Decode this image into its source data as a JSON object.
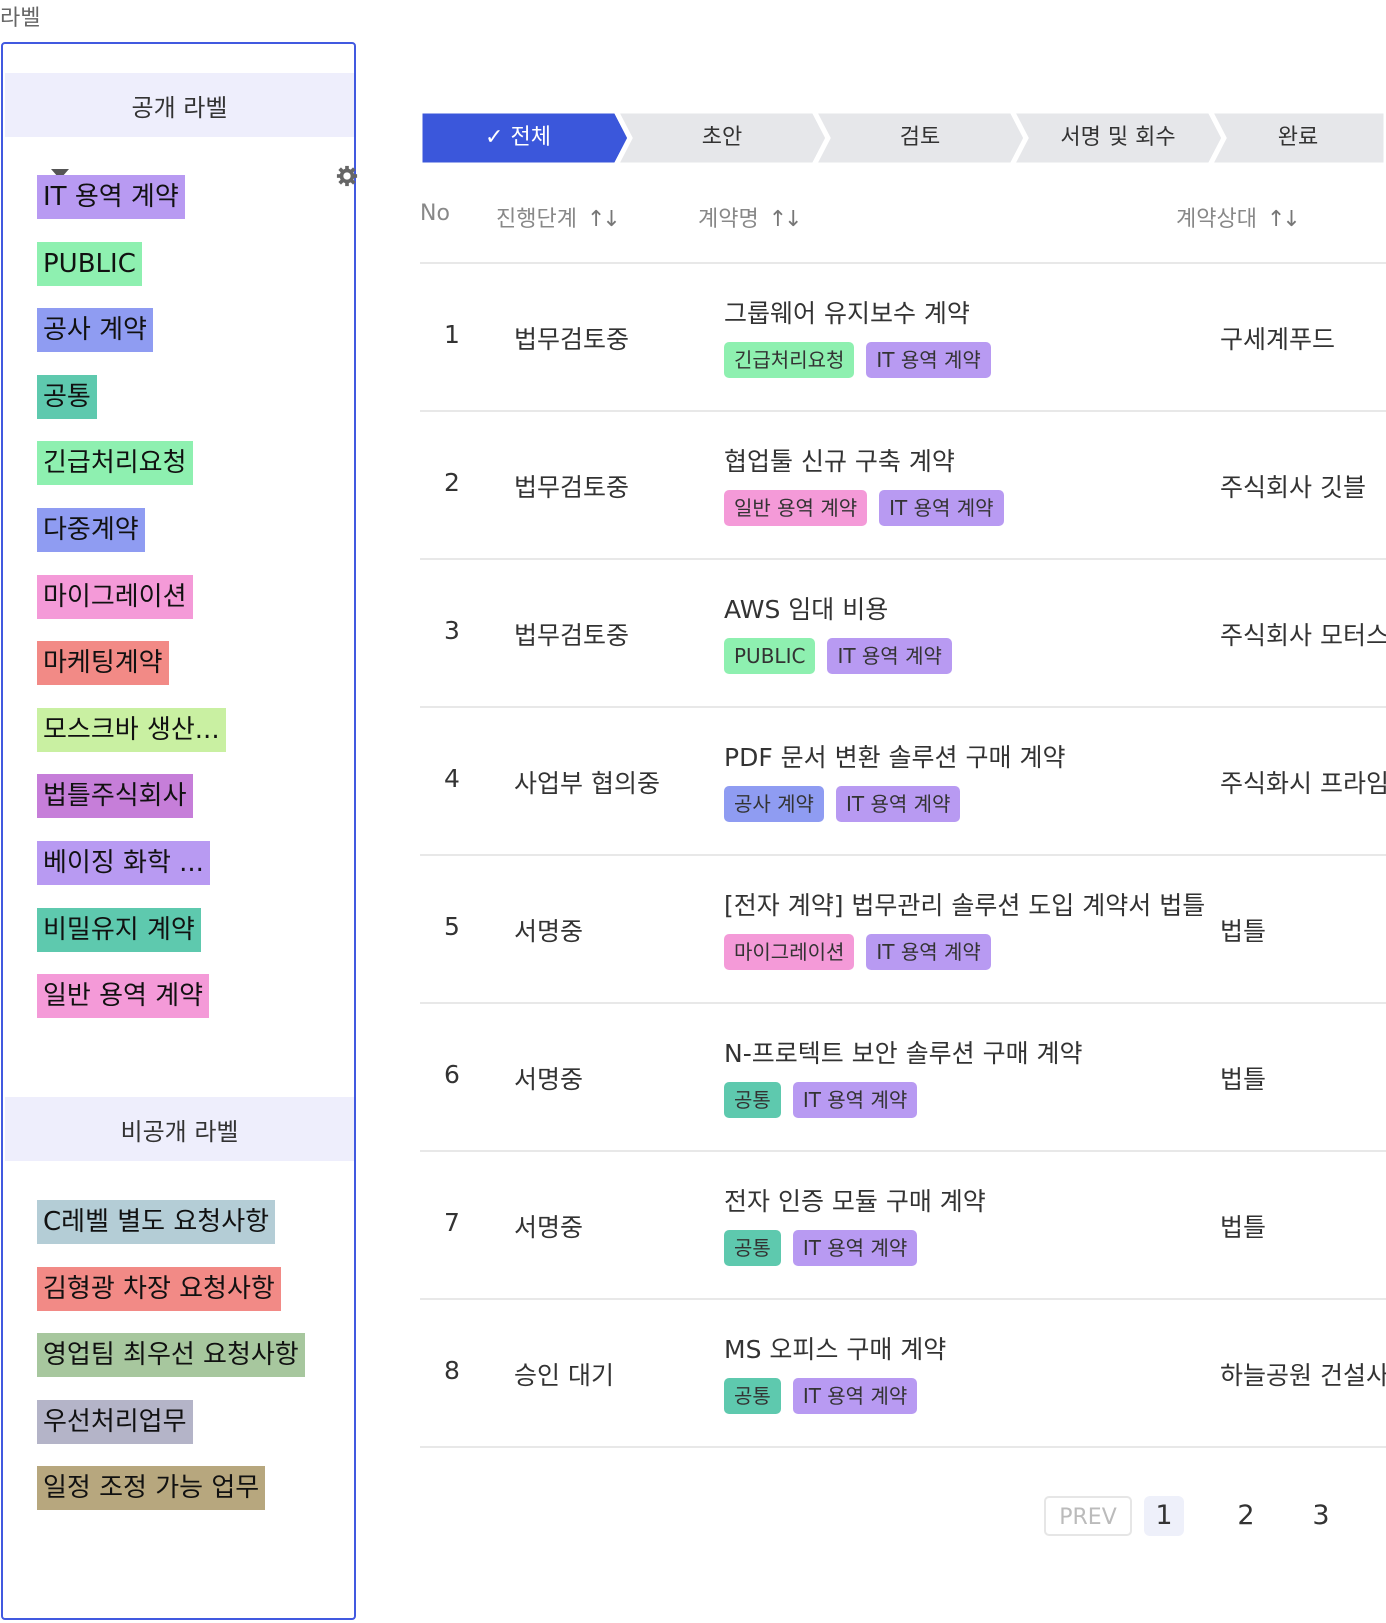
{
  "page": {
    "label": "라벨"
  },
  "sidebar": {
    "public_title": "공개 라벨",
    "private_title": "비공개 라벨",
    "filter_icon": "filter-icon",
    "settings_icon": "gear-icon",
    "public_labels": [
      {
        "label": "IT 용역 계약",
        "color": "#b89af2"
      },
      {
        "label": "PUBLIC",
        "color": "#8ef0b0"
      },
      {
        "label": "공사 계약",
        "color": "#8f9cf2"
      },
      {
        "label": "공통",
        "color": "#5ec9ae"
      },
      {
        "label": "긴급처리요청",
        "color": "#8ef0b0"
      },
      {
        "label": "다중계약",
        "color": "#8f9cf2"
      },
      {
        "label": "마이그레이션",
        "color": "#f49ad8"
      },
      {
        "label": "마케팅계약",
        "color": "#f28a86"
      },
      {
        "label": "모스크바 생산...",
        "color": "#c9f0a2"
      },
      {
        "label": "법틀주식회사",
        "color": "#c67ed9"
      },
      {
        "label": "베이징 화학 ...",
        "color": "#b89af2"
      },
      {
        "label": "비밀유지 계약",
        "color": "#5ec9ae"
      },
      {
        "label": "일반 용역 계약",
        "color": "#f49ad8"
      }
    ],
    "private_labels": [
      {
        "label": "C레벨 별도 요청사항",
        "color": "#b4cdd6"
      },
      {
        "label": "김형광 차장 요청사항",
        "color": "#f28a86"
      },
      {
        "label": "영업팀 최우선 요청사항",
        "color": "#a7c79e"
      },
      {
        "label": "우선처리업무",
        "color": "#b4b4c8"
      },
      {
        "label": "일정 조정 가능 업무",
        "color": "#b7a77e"
      }
    ]
  },
  "stepper": {
    "active_color": "#3b57db",
    "inactive_color": "#e6e7ea",
    "steps": [
      {
        "label": "✓ 전체",
        "active": true
      },
      {
        "label": "초안",
        "active": false
      },
      {
        "label": "검토",
        "active": false
      },
      {
        "label": "서명 및 회수",
        "active": false
      },
      {
        "label": "완료",
        "active": false
      }
    ]
  },
  "table": {
    "headers": {
      "no": "No",
      "stage": "진행단계",
      "name": "계약명",
      "party": "계약상대",
      "sort_icon": "↑↓"
    },
    "rows": [
      {
        "no": "1",
        "stage": "법무검토중",
        "name": "그룹웨어 유지보수 계약",
        "party": "구세계푸드",
        "tags": [
          {
            "label": "긴급처리요청",
            "color": "#8ef0b0"
          },
          {
            "label": "IT 용역 계약",
            "color": "#b89af2"
          }
        ]
      },
      {
        "no": "2",
        "stage": "법무검토중",
        "name": "협업툴 신규 구축 계약",
        "party": "주식회사 깃블",
        "tags": [
          {
            "label": "일반 용역 계약",
            "color": "#f49ad8"
          },
          {
            "label": "IT 용역 계약",
            "color": "#b89af2"
          }
        ]
      },
      {
        "no": "3",
        "stage": "법무검토중",
        "name": "AWS 임대 비용",
        "party": "주식회사 모터스",
        "tags": [
          {
            "label": "PUBLIC",
            "color": "#8ef0b0"
          },
          {
            "label": "IT 용역 계약",
            "color": "#b89af2"
          }
        ]
      },
      {
        "no": "4",
        "stage": "사업부 협의중",
        "name": "PDF 문서 변환 솔루션 구매 계약",
        "party": "주식화시 프라임",
        "tags": [
          {
            "label": "공사 계약",
            "color": "#8f9cf2"
          },
          {
            "label": "IT 용역 계약",
            "color": "#b89af2"
          }
        ]
      },
      {
        "no": "5",
        "stage": "서명중",
        "name": "[전자 계약] 법무관리 솔루션 도입 계약서 법틀",
        "party": "법틀",
        "tags": [
          {
            "label": "마이그레이션",
            "color": "#f49ad8"
          },
          {
            "label": "IT 용역 계약",
            "color": "#b89af2"
          }
        ]
      },
      {
        "no": "6",
        "stage": "서명중",
        "name": "N-프로텍트 보안 솔루션 구매 계약",
        "party": "법틀",
        "tags": [
          {
            "label": "공통",
            "color": "#5ec9ae"
          },
          {
            "label": "IT 용역 계약",
            "color": "#b89af2"
          }
        ]
      },
      {
        "no": "7",
        "stage": "서명중",
        "name": "전자 인증 모듈 구매 계약",
        "party": "법틀",
        "tags": [
          {
            "label": "공통",
            "color": "#5ec9ae"
          },
          {
            "label": "IT 용역 계약",
            "color": "#b89af2"
          }
        ]
      },
      {
        "no": "8",
        "stage": "승인 대기",
        "name": "MS 오피스 구매 계약",
        "party": "하늘공원 건설사",
        "tags": [
          {
            "label": "공통",
            "color": "#5ec9ae"
          },
          {
            "label": "IT 용역 계약",
            "color": "#b89af2"
          }
        ]
      }
    ]
  },
  "pagination": {
    "prev_label": "PREV",
    "pages": [
      "1",
      "2",
      "3"
    ],
    "current": "1"
  }
}
